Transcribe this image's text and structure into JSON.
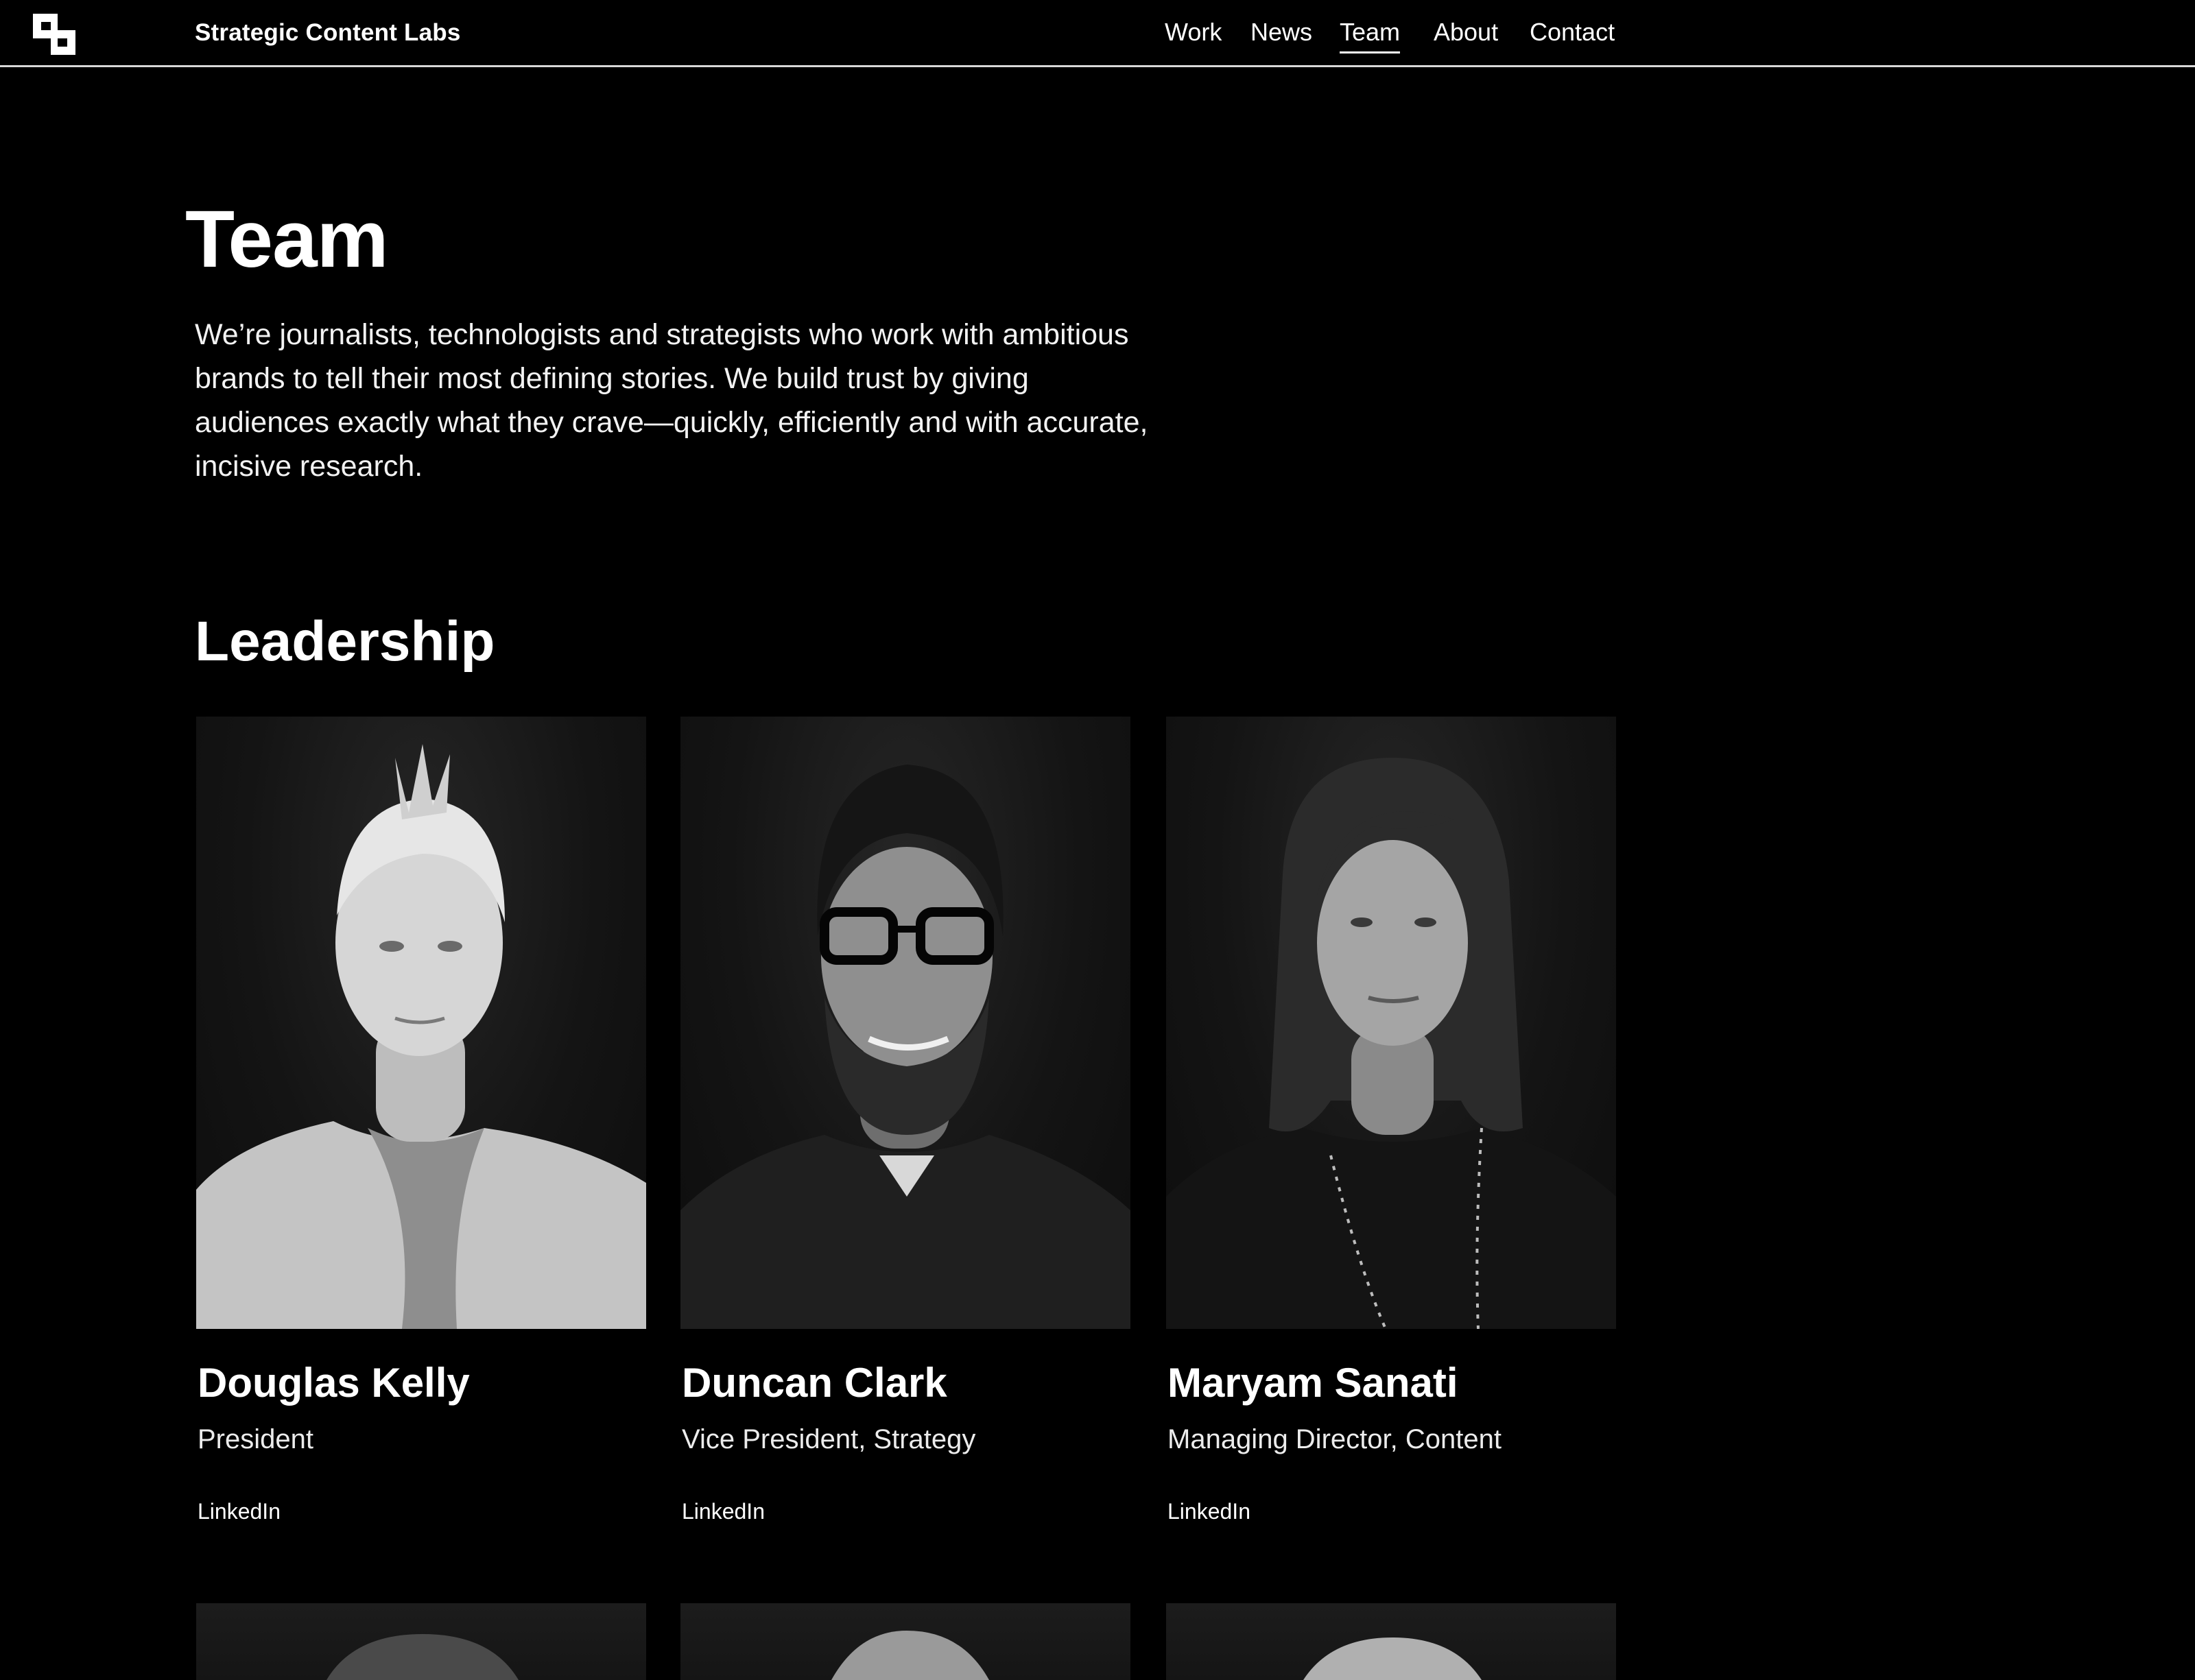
{
  "header": {
    "brand": "Strategic Content Labs",
    "logo_icon": "site-logo-icon",
    "nav": [
      {
        "label": "Work",
        "active": false
      },
      {
        "label": "News",
        "active": false
      },
      {
        "label": "Team",
        "active": true
      },
      {
        "label": "About",
        "active": false
      },
      {
        "label": "Contact",
        "active": false
      }
    ]
  },
  "page": {
    "title": "Team",
    "intro": "We’re journalists, technologists and strategists who work with ambitious brands to tell their most defining stories. We build trust by giving audiences exactly what they crave—quickly, efficiently and with accurate, incisive research."
  },
  "leadership": {
    "heading": "Leadership",
    "members": [
      {
        "name": "Douglas Kelly",
        "role": "President",
        "link": "LinkedIn"
      },
      {
        "name": "Duncan Clark",
        "role": "Vice President, Strategy",
        "link": "LinkedIn"
      },
      {
        "name": "Maryam Sanati",
        "role": "Managing Director, Content",
        "link": "LinkedIn"
      }
    ]
  },
  "theme": {
    "background": "#000000",
    "text": "#ffffff",
    "divider": "#d8d8d8"
  }
}
